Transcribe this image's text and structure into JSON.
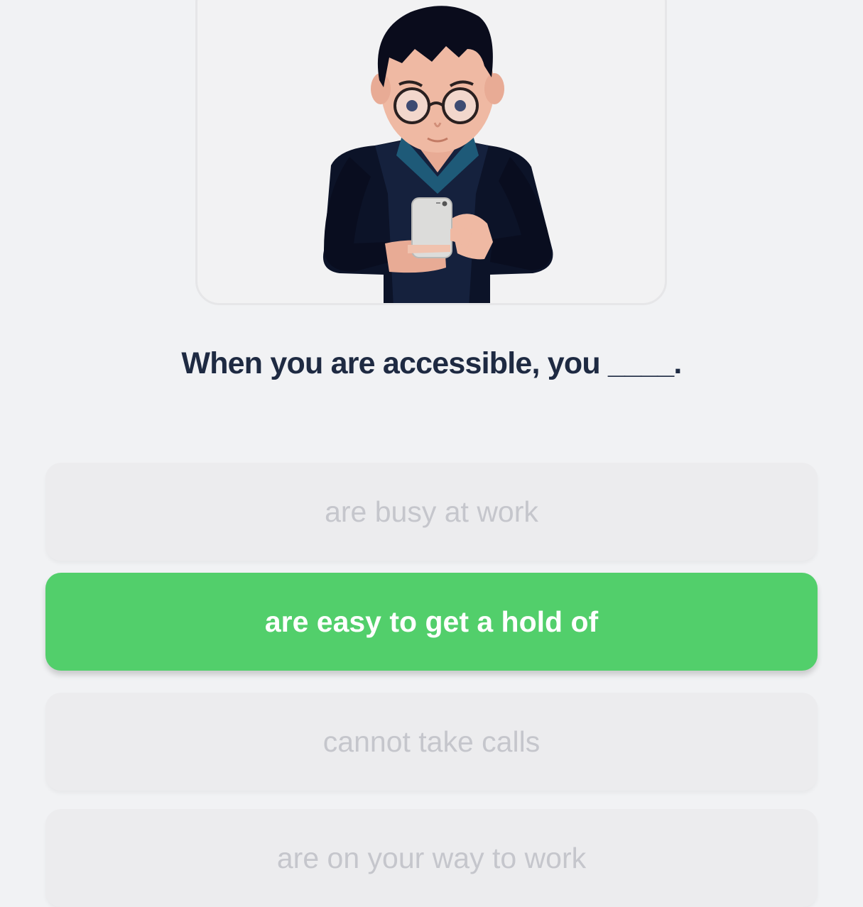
{
  "question": {
    "text": "When you are accessible, you ____."
  },
  "illustration": {
    "icon": "person-with-phone-illustration"
  },
  "options": [
    {
      "label": "are busy at work",
      "selected": false
    },
    {
      "label": "are easy to get a hold of",
      "selected": true
    },
    {
      "label": "cannot take calls",
      "selected": false
    },
    {
      "label": "are on your way to work",
      "selected": false
    }
  ],
  "colors": {
    "selected": "#52cf6b",
    "unselected_bg": "#ececee",
    "unselected_text": "#c5c6cc",
    "question_text": "#1e2a42",
    "background": "#f1f2f4"
  }
}
